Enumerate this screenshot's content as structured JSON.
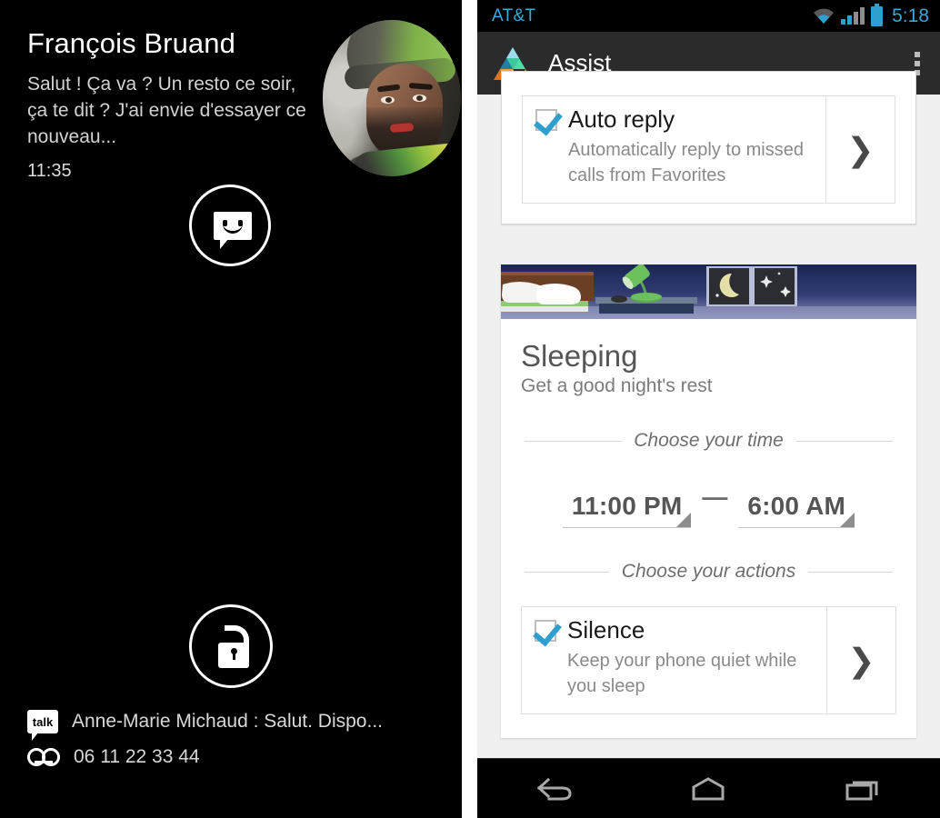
{
  "lockscreen": {
    "notification": {
      "sender": "François Bruand",
      "message": "Salut ! Ça va ? Un resto ce soir, ça te dit ? J'ai envie d'essayer ce nouveau...",
      "time": "11:35",
      "app_icon": "message-bubble-icon",
      "avatar_alt": "contact-photo"
    },
    "unlock_icon": "unlock-icon",
    "status_items": [
      {
        "icon": "talk-icon",
        "icon_label": "talk",
        "text": "Anne-Marie Michaud : Salut. Dispo..."
      },
      {
        "icon": "voicemail-icon",
        "icon_label": "",
        "text": "06 11 22 33 44"
      }
    ]
  },
  "phone": {
    "statusbar": {
      "carrier": "AT&T",
      "clock": "5:18",
      "icons": [
        "wifi-icon",
        "signal-icon",
        "battery-icon"
      ],
      "accent_color": "#3aa8d8"
    },
    "actionbar": {
      "logo": "assist-logo-icon",
      "title": "Assist",
      "overflow": "overflow-menu-icon"
    },
    "cards": [
      {
        "id": "auto-reply-card",
        "option": {
          "checked": true,
          "title": "Auto reply",
          "description": "Automatically reply to missed calls from Favorites",
          "arrow": "chevron-right-icon"
        }
      },
      {
        "id": "sleeping-card",
        "hero_illustration": "bedroom-night-illustration",
        "title": "Sleeping",
        "subtitle": "Get a good night's rest",
        "time_section_label": "Choose your time",
        "time_start": "11:00 PM",
        "time_separator": "—",
        "time_end": "6:00 AM",
        "actions_section_label": "Choose your actions",
        "option": {
          "checked": true,
          "title": "Silence",
          "description": "Keep your phone quiet while you sleep",
          "arrow": "chevron-right-icon"
        }
      }
    ],
    "navbar": {
      "back": "back-icon",
      "home": "home-icon",
      "recents": "recents-icon"
    },
    "colors": {
      "accent": "#2f9fd0",
      "card_bg": "#ffffff",
      "page_bg": "#f0f0f0",
      "actionbar_bg": "#2b2b2b"
    }
  }
}
